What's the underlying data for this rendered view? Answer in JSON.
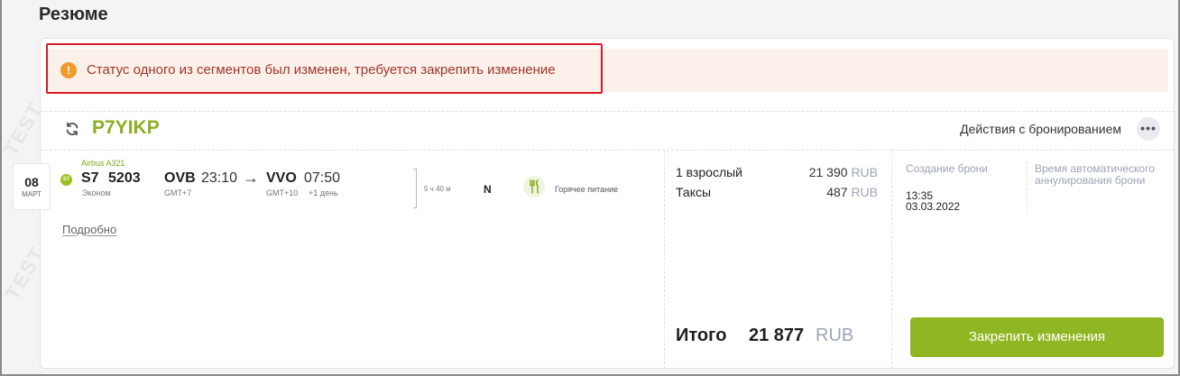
{
  "page": {
    "title": "Резюме"
  },
  "watermark": "TEST",
  "alert": {
    "text": "Статус одного из сегментов был изменен, требуется закрепить изменение",
    "icon": "!"
  },
  "booking": {
    "pnr": "P7YIKP",
    "actions_label": "Действия с бронированием",
    "more_label": "•••"
  },
  "segment": {
    "date_day": "08",
    "date_month": "МАРТ",
    "airline_logo": "S7",
    "aircraft": "Airbus A321",
    "flight_number": "S7 5203",
    "cabin": "Эконом",
    "departure": {
      "airport": "OVB",
      "time": "23:10",
      "tz": "GMT+7"
    },
    "arrow": "→",
    "arrival": {
      "airport": "VVO",
      "time": "07:50",
      "tz": "GMT+10",
      "next_day": "+1 день"
    },
    "duration": "5 ч 40 м",
    "booking_class": "N",
    "meal": "Горячее питание",
    "details_link": "Подробно"
  },
  "pricing": {
    "rows": [
      {
        "label": "1 взрослый",
        "amount": "21 390",
        "currency": "RUB"
      },
      {
        "label": "Таксы",
        "amount": "487",
        "currency": "RUB"
      }
    ],
    "total_label": "Итого",
    "total_amount": "21 877",
    "total_currency": "RUB"
  },
  "info": {
    "created_label": "Создание брони",
    "created_time": "13:35",
    "created_date": "03.03.2022",
    "auto_cancel_label": "Время автоматического аннулирования брони"
  },
  "commit_button": "Закрепить изменения",
  "colors": {
    "accent": "#91b623",
    "pnr": "#8ab022",
    "alert_bg": "#fcf1ea",
    "alert_text": "#a0362e",
    "highlight": "#d9192a"
  }
}
